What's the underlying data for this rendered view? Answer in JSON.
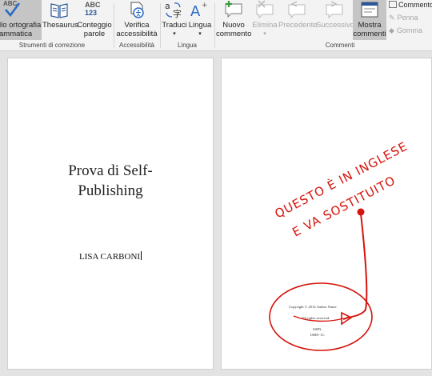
{
  "ribbon": {
    "groups": {
      "proofing": "Strumenti di correzione",
      "accessibility": "Accessibilità",
      "language": "Lingua",
      "comments": "Commenti"
    },
    "spelling": {
      "icon_text": "ABC",
      "line1": "llo ortografia",
      "line2": "ammatica"
    },
    "thesaurus": {
      "label": "Thesaurus"
    },
    "word_count": {
      "icon_text": "ABC\n123",
      "line1": "Conteggio",
      "line2": "parole"
    },
    "accessibility_check": {
      "line1": "Verifica",
      "line2": "accessibilità"
    },
    "translate": {
      "label": "Traduci",
      "chevron": "▾"
    },
    "language": {
      "label": "Lingua",
      "chevron": "▾"
    },
    "new_comment": {
      "line1": "Nuovo",
      "line2": "commento"
    },
    "delete": {
      "label": "Elimina",
      "chevron": "▾"
    },
    "previous": {
      "label": "Precedente"
    },
    "next": {
      "label": "Successivo"
    },
    "show_comments": {
      "line1": "Mostra",
      "line2": "commenti"
    },
    "side_items": [
      "Commento",
      "Penna",
      "Gomma"
    ]
  },
  "pages": {
    "title_line1": "Prova di Self-",
    "title_line2": "Publishing",
    "author": "LISA CARBONI",
    "copyright": "Copyright © 2012 Author Name",
    "rights": "All rights reserved.",
    "isbn": "ISBN:",
    "isbn13": "ISBN-13:",
    "handwriting_line1": "QUESTO È IN INGLESE",
    "handwriting_line2": "E VA SOSTITUITO"
  },
  "colors": {
    "ink": "#d6140c",
    "ribbon_bg": "#f3f3f3",
    "selected": "#c5c5c5",
    "blue_icon": "#2b5797"
  }
}
